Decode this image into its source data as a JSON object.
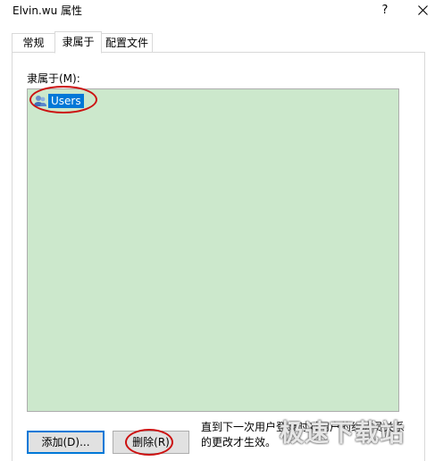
{
  "window": {
    "title": "Elvin.wu 属性",
    "help_label": "?"
  },
  "tabs": [
    {
      "label": "常规"
    },
    {
      "label": "隶属于"
    },
    {
      "label": "配置文件"
    }
  ],
  "membership": {
    "label": "隶属于(M):",
    "items": [
      {
        "label": "Users",
        "icon": "group-icon",
        "selected": true
      }
    ]
  },
  "buttons": {
    "add_label": "添加(D)...",
    "remove_label": "删除(R)"
  },
  "note": "直到下一次用户登录时对用户的组成员关系的更改才生效。",
  "watermark": "极速下载站",
  "colors": {
    "list_background": "#cce8cc",
    "selection": "#0078d7",
    "annotation_circle": "#cc1111"
  }
}
